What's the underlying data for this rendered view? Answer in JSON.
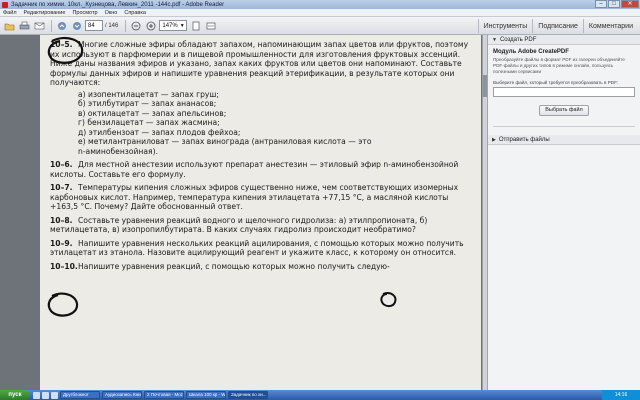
{
  "window": {
    "title": "Задачник по химии. 10кл._Кузнецова, Левкин_2011 -144с.pdf - Adobe Reader",
    "btn_minimize": "–",
    "btn_maximize": "□",
    "btn_close": "✕"
  },
  "menu": {
    "items": [
      "Файл",
      "Редактирование",
      "Просмотр",
      "Окно",
      "Справка"
    ]
  },
  "toolbar": {
    "page_current": "84",
    "page_total": "/ 146",
    "zoom": "147%",
    "tabs": [
      "Инструменты",
      "Подписание",
      "Комментарии"
    ],
    "icons": [
      "open-icon",
      "print-icon",
      "email-icon",
      "prev-page-icon",
      "next-page-icon",
      "zoom-out-icon",
      "zoom-in-icon",
      "fit-page-icon",
      "fit-width-icon"
    ]
  },
  "document": {
    "p1_num": "10–5.",
    "p1_text": "Многие сложные эфиры обладают запахом, напоминающим запах цветов или фруктов, поэтому их используют в парфюмерии и в пищевой промышленности для изготовления фруктовых эссенций. Ниже даны названия эфиров и указано, запах каких фруктов или цветов они напоминают. Составьте формулы данных эфиров и напишите уравнения реакций этерификации, в результате которых они получаются:",
    "p1_list": [
      "а) изопентилацетат — запах груш;",
      "б) этилбутират — запах ананасов;",
      "в) октилацетат — запах апельсинов;",
      "г) бензилацетат — запах жасмина;",
      "д) этилбензоат — запах плодов фейхоа;",
      "е) метилантраниловат — запах винограда (антраниловая кислота — это"
    ],
    "p1_list_cont": "n-аминобензойная).",
    "p2_num": "10–6.",
    "p2_text": "Для местной анестезии используют препарат анестезин — этиловый эфир n-аминобензойной кислоты. Составьте его формулу.",
    "p3_num": "10–7.",
    "p3_text": "Температуры кипения сложных эфиров существенно ниже, чем соответствующих изомерных карбоновых кислот. Например, температура кипения этилацетата +77,15 °С, а масляной кислоты +163,5 °С. Почему? Дайте обоснованный ответ.",
    "p4_num": "10–8.",
    "p4_text": "Составьте уравнения реакций водного и щелочного гидролиза: а) этилпропионата, б) метилацетата, в) изопропилбутирата. В каких случаях гидролиз происходит необратимо?",
    "p5_num": "10–9.",
    "p5_text": "Напишите уравнения нескольких реакций ацилирования, с помощью которых можно получить этилацетат из этанола. Назовите ацилирующий реагент и укажите класс, к которому он относится.",
    "p6_num": "10–10.",
    "p6_text": "Напишите уравнения реакций, с помощью которых можно получить следую-"
  },
  "panel": {
    "create_pdf_head": "Создать PDF",
    "title": "Модуль Adobe CreatePDF",
    "desc": "Преобразуйте файлы в формат PDF из галереи объединяйте PDF-файлы и других типов в режиме онлайн, пользуясь полезными сервисами",
    "file_label": "Выберите файл, который требуется преобразовать в PDF:",
    "select_btn": "Выбрать файл",
    "send_files_head": "Отправить файлы"
  },
  "taskbar": {
    "start": "пуск",
    "tasks": [
      "Другблокнот",
      "Аудиозапись Книга",
      "2 Почтовая - Mozilla",
      "Шкала 100 кр - Winr",
      "Задачник по хи..."
    ],
    "clock": "14:16"
  }
}
